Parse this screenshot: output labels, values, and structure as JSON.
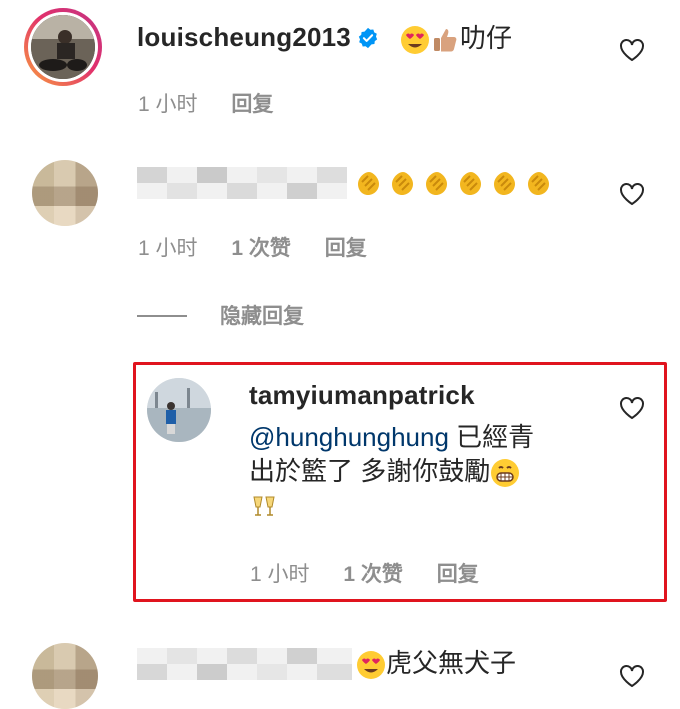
{
  "comments": [
    {
      "username": "louischeung2013",
      "verified": true,
      "text": "叻仔",
      "emojis": [
        "heart-eyes-emoji",
        "thumbs-up-emoji"
      ],
      "time": "1 小时",
      "reply": "回复"
    },
    {
      "username_blurred": true,
      "emojis": [
        "clap-emoji",
        "clap-emoji",
        "clap-emoji",
        "clap-emoji",
        "clap-emoji",
        "clap-emoji"
      ],
      "time": "1 小时",
      "likes": "1 次赞",
      "reply": "回复",
      "toggle_replies": "隐藏回复"
    },
    {
      "username": "tamyiumanpatrick",
      "mention": "@hunghunghung",
      "text_line1": " 已經青",
      "text_line2": "出於籃了 多謝你鼓勵",
      "emojis": [
        "grin-emoji",
        "cheers-emoji"
      ],
      "time": "1 小时",
      "likes": "1 次赞",
      "reply": "回复"
    },
    {
      "username_blurred": true,
      "text": "虎父無犬子",
      "emojis": [
        "heart-eyes-emoji"
      ]
    }
  ],
  "colors": {
    "highlight_border": "#e0141e",
    "verified_badge": "#0095f6",
    "mention": "#00376b",
    "meta_text": "#8e8e8e"
  }
}
